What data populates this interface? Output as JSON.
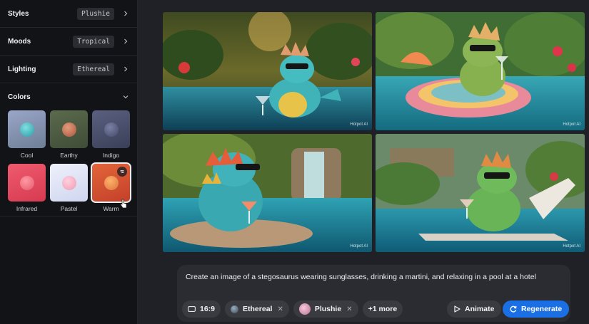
{
  "sidebar": {
    "options": [
      {
        "label": "Styles",
        "value": "Plushie"
      },
      {
        "label": "Moods",
        "value": "Tropical"
      },
      {
        "label": "Lighting",
        "value": "Ethereal"
      }
    ],
    "colors_heading": "Colors",
    "swatches": [
      {
        "name": "Cool",
        "bg": "#7d8fa8",
        "ball": "#48b5bd"
      },
      {
        "name": "Earthy",
        "bg": "#4b5c42",
        "ball": "#c9765a"
      },
      {
        "name": "Indigo",
        "bg": "#4a4f6a",
        "ball": "#5a6082"
      },
      {
        "name": "Infrared",
        "bg": "#e2475c",
        "ball": "#f07380"
      },
      {
        "name": "Pastel",
        "bg": "#dfe3f5",
        "ball": "#f4b0c3"
      },
      {
        "name": "Warm",
        "bg": "#d8502f",
        "ball": "#e98b4b"
      }
    ]
  },
  "images": [
    {
      "watermark": "Hotpot AI"
    },
    {
      "watermark": "Hotpot AI"
    },
    {
      "watermark": "Hotpot AI"
    },
    {
      "watermark": "Hotpot AI"
    }
  ],
  "prompt": {
    "text": "Create an image of a stegosaurus wearing sunglasses, drinking a martini, and relaxing in a pool at a hotel",
    "aspect": "16:9",
    "tag_lighting": "Ethereal",
    "tag_style": "Plushie",
    "more": "+1 more",
    "animate_label": "Animate",
    "regenerate_label": "Regenerate"
  },
  "colors": {
    "accent": "#1b6fe4",
    "sidebar_bg": "#121316",
    "main_bg": "#202126"
  }
}
